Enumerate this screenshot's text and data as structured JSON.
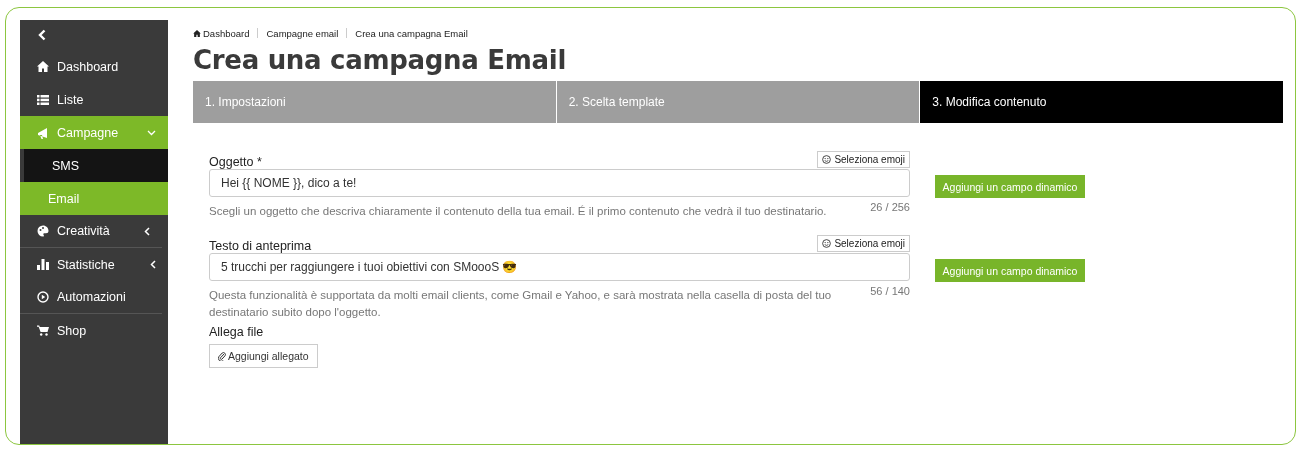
{
  "sidebar": {
    "items": [
      {
        "kind": "back"
      },
      {
        "kind": "link",
        "label": "Dashboard"
      },
      {
        "kind": "link",
        "label": "Liste"
      },
      {
        "kind": "group",
        "label": "Campagne",
        "selected": true,
        "expanded": true,
        "children": [
          {
            "label": "SMS",
            "selected": false
          },
          {
            "label": "Email",
            "selected": true
          }
        ]
      },
      {
        "kind": "group",
        "label": "Creatività",
        "selected": false,
        "expanded": false,
        "separator": true
      },
      {
        "kind": "group",
        "label": "Statistiche",
        "selected": false,
        "expanded": false
      },
      {
        "kind": "link",
        "label": "Automazioni",
        "separator": true
      },
      {
        "kind": "link",
        "label": "Shop"
      }
    ]
  },
  "breadcrumb": [
    "Dashboard",
    "Campagne email",
    "Crea una campagna Email"
  ],
  "title": "Crea una campagna Email",
  "steps": [
    {
      "label": "1. Impostazioni",
      "selected": false
    },
    {
      "label": "2. Scelta template",
      "selected": false
    },
    {
      "label": "3. Modifica contenuto",
      "selected": true
    }
  ],
  "fields": [
    {
      "label": "Oggetto *",
      "emoji_button": "Seleziona emoji",
      "value": "Hei {{ NOME }}, dico a te!",
      "help": "Scegli un oggetto che descriva chiaramente il contenuto della tua email. É il primo contenuto che vedrà il tuo destinatario.",
      "counter": "26 / 256",
      "action": "Aggiungi un campo dinamico"
    },
    {
      "label": "Testo di anteprima",
      "emoji_button": "Seleziona emoji",
      "value": "5 trucchi per raggiungere i tuoi obiettivi con SMoooS 😎",
      "help": "Questa funzionalità è supportata da molti email clients, come Gmail e Yahoo, e sarà mostrata nella casella di posta del tuo destinatario subito dopo l'oggetto.",
      "counter": "56 / 140",
      "action": "Aggiungi un campo dinamico"
    }
  ],
  "attachment": {
    "label": "Allega file",
    "button": "Aggiungi allegato"
  }
}
